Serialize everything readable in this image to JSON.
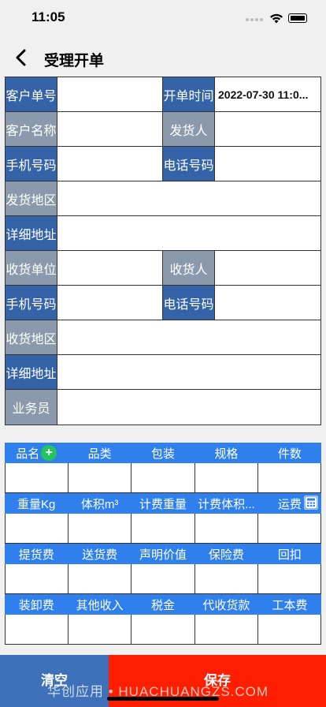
{
  "status": {
    "time": "11:05"
  },
  "nav": {
    "title": "受理开单"
  },
  "form": {
    "rows": [
      {
        "label": "客户单号",
        "label2": "开单时间",
        "value2": "2022-07-30 11:0..."
      },
      {
        "label": "客户名称",
        "label2": "发货人"
      },
      {
        "label": "手机号码",
        "label2": "电话号码"
      },
      {
        "label": "发货地区"
      },
      {
        "label": "详细地址"
      },
      {
        "label": "收货单位",
        "label2": "收货人"
      },
      {
        "label": "手机号码",
        "label2": "电话号码"
      },
      {
        "label": "收货地区"
      },
      {
        "label": "详细地址"
      },
      {
        "label": "业务员"
      }
    ]
  },
  "grid": {
    "sections": [
      [
        "品名",
        "品类",
        "包装",
        "规格",
        "件数"
      ],
      [
        "重量Kg",
        "体积m³",
        "计费重量",
        "计费体积...",
        "运费"
      ],
      [
        "提货费",
        "送货费",
        "声明价值",
        "保险费",
        "回扣"
      ],
      [
        "装卸费",
        "其他收入",
        "税金",
        "代收货款",
        "工本费"
      ]
    ]
  },
  "buttons": {
    "clear": "清空",
    "save": "保存"
  },
  "watermark": "华创应用 • HUACHUANGZS.COM",
  "colors": {
    "label_blue": "#3563a8",
    "label_gray": "#8a99ab",
    "header_blue": "#2f80ed",
    "save_red": "#ff1e00",
    "clear_blue": "#3f70ba"
  }
}
